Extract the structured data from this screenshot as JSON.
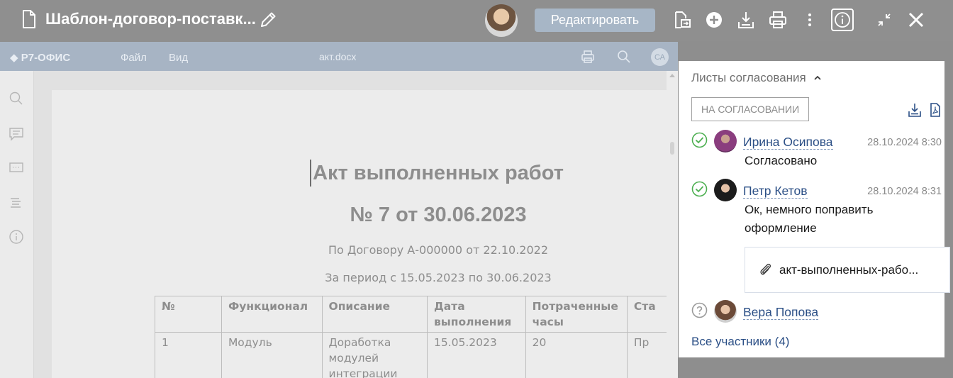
{
  "topbar": {
    "title": "Шаблон-договор-поставк...",
    "edit_label": "Редактировать",
    "icons": [
      "file-icon",
      "pencil-icon",
      "file-move-icon",
      "plus-circle-icon",
      "download-icon",
      "print-icon",
      "more-vertical-icon",
      "info-icon",
      "collapse-icon",
      "close-icon"
    ]
  },
  "editor": {
    "logo": "Р7-ОФИС",
    "menu": [
      "Файл",
      "Вид"
    ],
    "filename": "акт.docx",
    "user_initials": "СА",
    "document": {
      "title_line1": "Акт выполненных работ",
      "title_line2": "№ 7 от 30.06.2023",
      "subtitle1": "По Договору А-000000 от 22.10.2022",
      "subtitle2": "За период с 15.05.2023 по 30.06.2023",
      "table": {
        "headers": [
          "№",
          "Функционал",
          "Описание",
          "Дата выполнения",
          "Потраченные часы",
          "Ста"
        ],
        "rows": [
          [
            "1",
            "Модуль",
            "Доработка модулей интеграции",
            "15.05.2023",
            "20",
            "Пр"
          ]
        ]
      }
    }
  },
  "panel": {
    "title": "Листы согласования",
    "status": "НА СОГЛАСОВАНИИ",
    "approvals": [
      {
        "name": "Ирина Осипова",
        "date": "28.10.2024 8:30",
        "comment": "Согласовано",
        "state": "approved"
      },
      {
        "name": "Петр Кетов",
        "date": "28.10.2024 8:31",
        "comment": "Ок, немного поправить оформление",
        "state": "approved"
      },
      {
        "name": "Вера Попова",
        "date": "",
        "comment": "",
        "state": "pending"
      }
    ],
    "attachment": "акт-выполненных-рабо...",
    "all_link": "Все участники (4)"
  },
  "colors": {
    "accent_link": "#2b4f86",
    "approved_green": "#4caf50",
    "edit_button": "#a7b6c6"
  }
}
